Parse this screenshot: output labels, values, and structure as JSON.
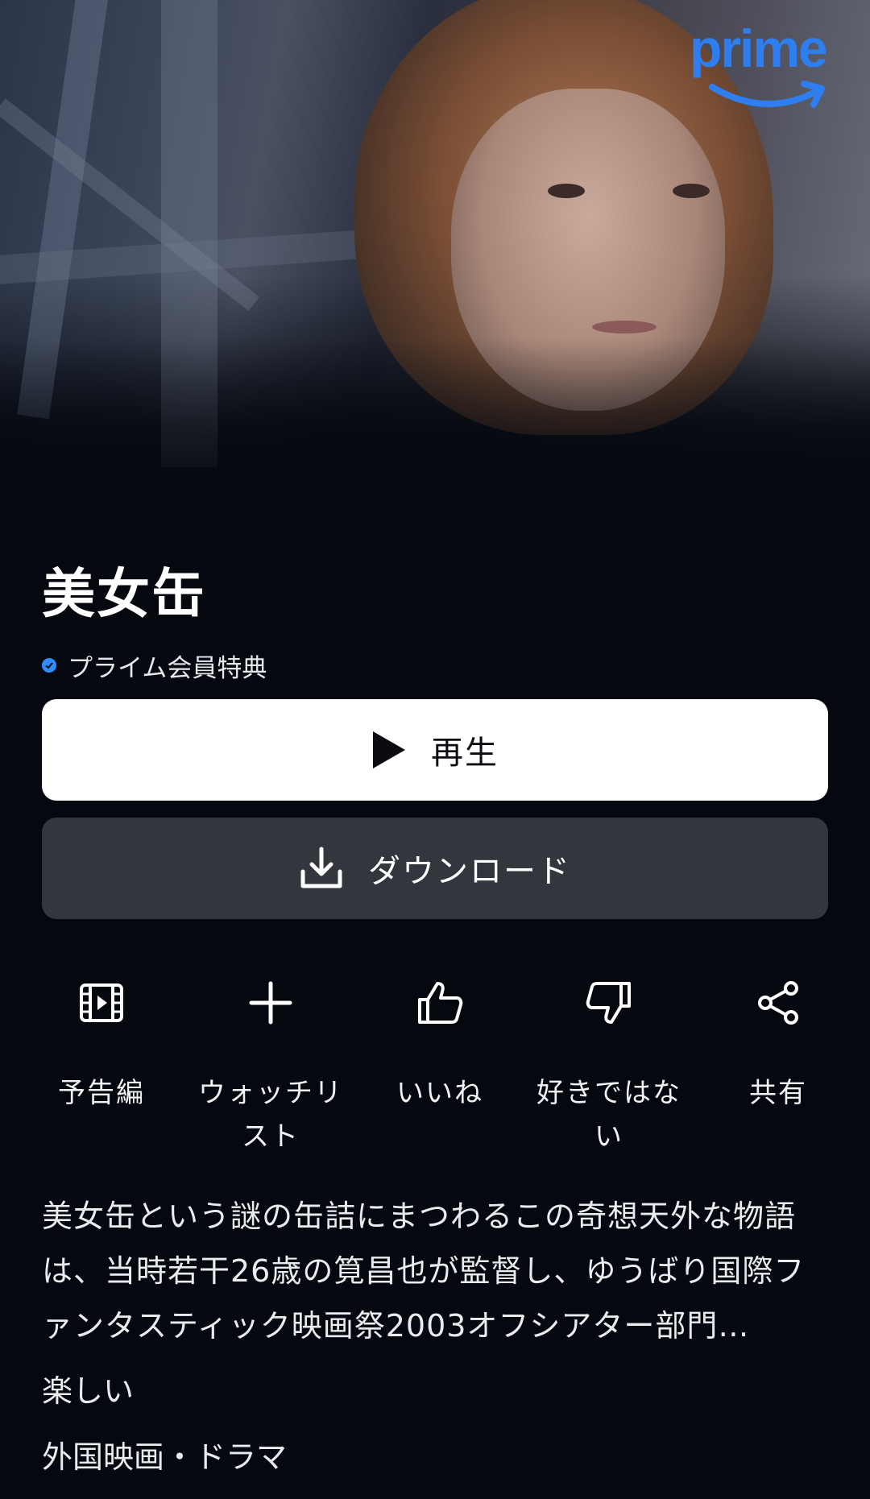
{
  "hero": {
    "image_alt": "hero-image"
  },
  "brand": {
    "logo_text": "prime",
    "accent": "#2f7ef0"
  },
  "title": "美女缶",
  "prime_badge": {
    "label": "プライム会員特典",
    "icon": "check-circle-icon",
    "color": "#2f8cff"
  },
  "buttons": {
    "play_label": "再生",
    "download_label": "ダウンロード"
  },
  "actions": [
    {
      "label": "予告編",
      "icon": "film-icon"
    },
    {
      "label": "ウォッチリスト",
      "icon": "plus-icon"
    },
    {
      "label": "いいね",
      "icon": "thumbs-up-icon"
    },
    {
      "label": "好きではない",
      "icon": "thumbs-down-icon"
    },
    {
      "label": "共有",
      "icon": "share-icon"
    }
  ],
  "description": "美女缶という謎の缶詰にまつわるこの奇想天外な物語は、当時若干26歳の筧昌也が監督し、ゆうばり国際ファンタスティック映画祭2003オフシアター部門…",
  "mood": "楽しい",
  "genre": "外国映画・ドラマ"
}
